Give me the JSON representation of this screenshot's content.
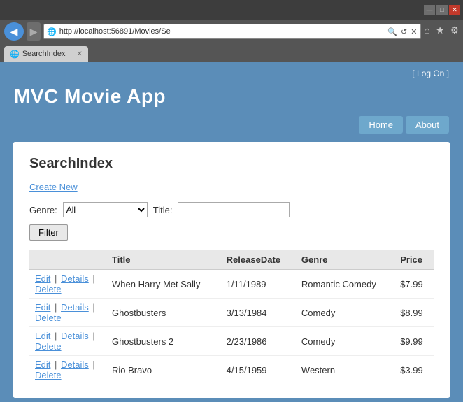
{
  "browser": {
    "address": "http://localhost:56891/Movies/Se",
    "tab_title": "SearchIndex",
    "tab_favicon": "🌐",
    "btn_minimize": "—",
    "btn_maximize": "□",
    "btn_close": "✕",
    "back_arrow": "◀",
    "forward_arrow": "▶",
    "address_search_icon": "🔒",
    "toolbar_home": "⌂",
    "toolbar_star": "★",
    "toolbar_gear": "⚙"
  },
  "header": {
    "log_on": "[ Log On ]",
    "app_title": "MVC Movie App",
    "nav_home": "Home",
    "nav_about": "About"
  },
  "page": {
    "heading": "SearchIndex",
    "create_new": "Create New",
    "genre_label": "Genre:",
    "genre_value": "All",
    "title_label": "Title:",
    "title_placeholder": "",
    "filter_btn": "Filter",
    "table": {
      "columns": [
        "",
        "Title",
        "ReleaseDate",
        "Genre",
        "Price"
      ],
      "rows": [
        {
          "actions": [
            "Edit",
            "Details",
            "Delete"
          ],
          "title": "When Harry Met Sally",
          "release_date": "1/11/1989",
          "genre": "Romantic Comedy",
          "price": "$7.99"
        },
        {
          "actions": [
            "Edit",
            "Details",
            "Delete"
          ],
          "title": "Ghostbusters",
          "release_date": "3/13/1984",
          "genre": "Comedy",
          "price": "$8.99"
        },
        {
          "actions": [
            "Edit",
            "Details",
            "Delete"
          ],
          "title": "Ghostbusters 2",
          "release_date": "2/23/1986",
          "genre": "Comedy",
          "price": "$9.99"
        },
        {
          "actions": [
            "Edit",
            "Details",
            "Delete"
          ],
          "title": "Rio Bravo",
          "release_date": "4/15/1959",
          "genre": "Western",
          "price": "$3.99"
        }
      ]
    }
  }
}
